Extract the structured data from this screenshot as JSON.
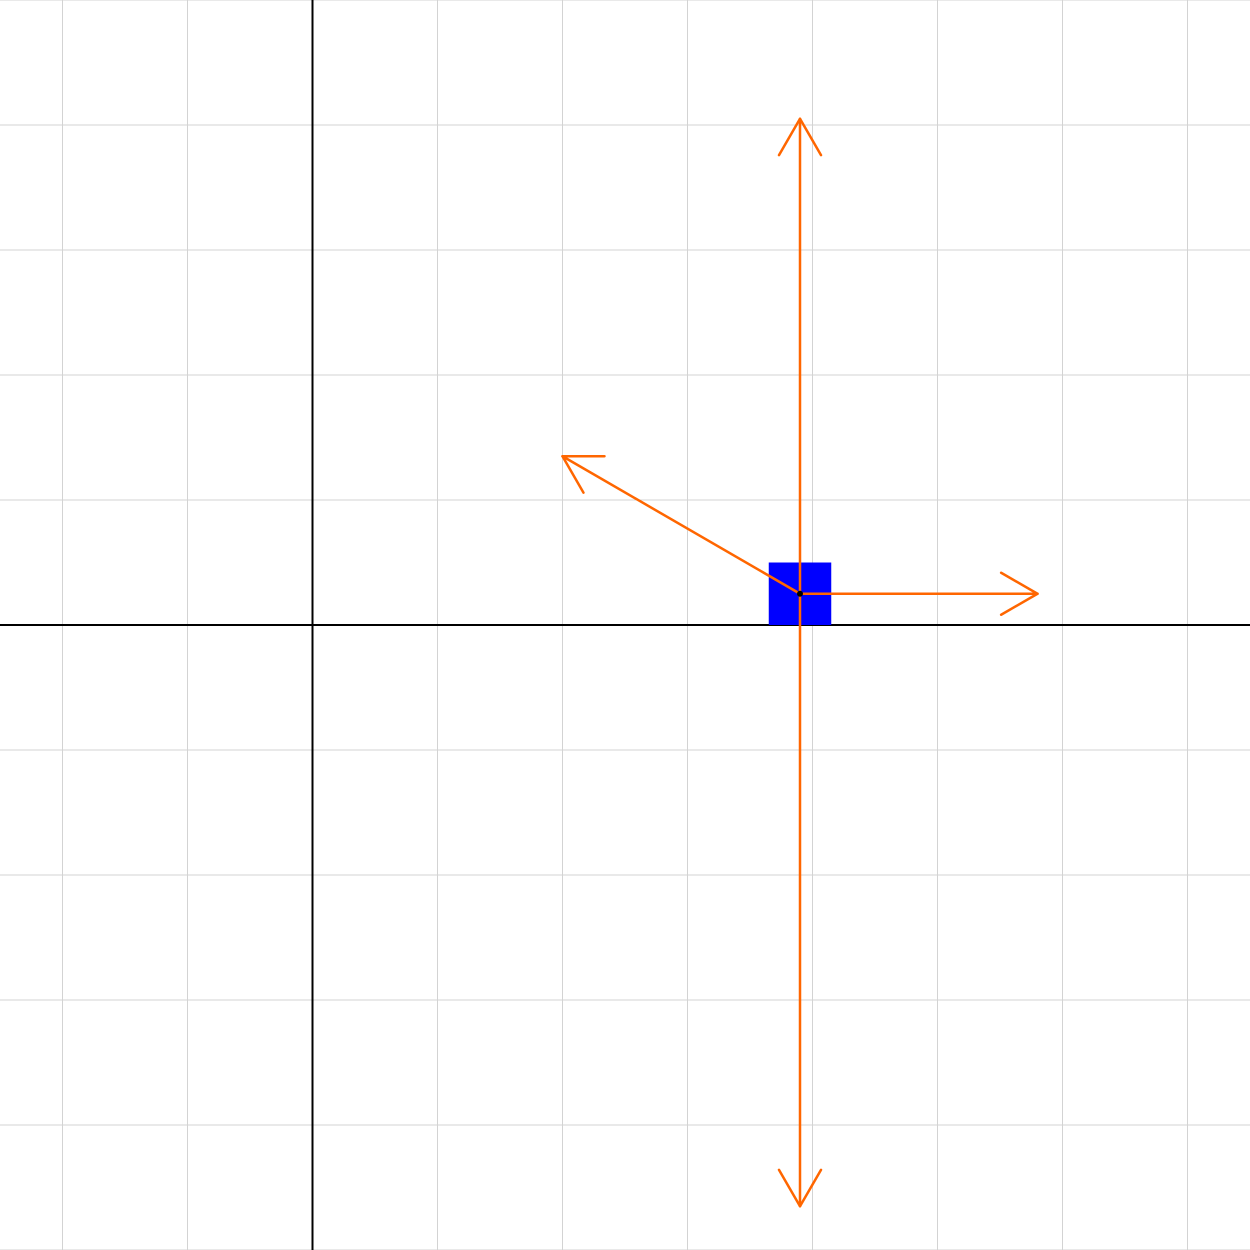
{
  "colors": {
    "background": "#ffffff",
    "grid": "#d3d3d3",
    "axis": "#000000",
    "block": "#0000ff",
    "vector": "#ff6600",
    "point": "#000000"
  },
  "scene": {
    "grid_spacing": 1,
    "x_range": [
      -2.5,
      7.5
    ],
    "y_range": [
      -5,
      5
    ],
    "block": {
      "center": [
        3.9,
        0.25
      ],
      "width": 0.5,
      "height": 0.5,
      "sits_on_axis": true
    },
    "force_vectors": [
      {
        "name": "normal-force-arrow",
        "dx": 0,
        "dy": 3.8
      },
      {
        "name": "weight-arrow",
        "dx": 0,
        "dy": -4.9
      },
      {
        "name": "applied-force-arrow",
        "dx": 1.9,
        "dy": 0
      },
      {
        "name": "tension-arrow",
        "dx": -1.9,
        "dy": 1.1
      }
    ]
  }
}
